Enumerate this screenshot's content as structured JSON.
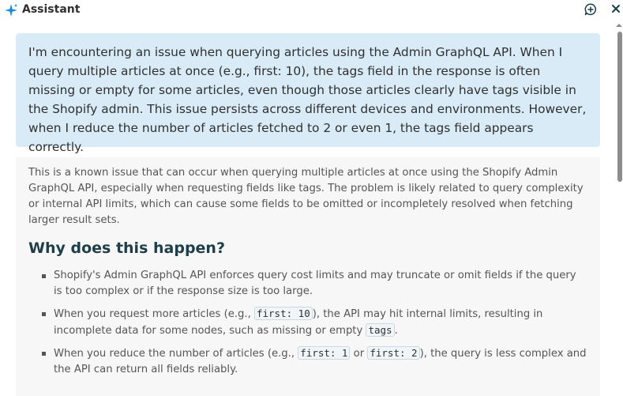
{
  "header": {
    "title": "Assistant",
    "icons": [
      "sparkle-icon",
      "new-chat-icon",
      "close-icon"
    ]
  },
  "colors": {
    "user_bubble_bg": "#d8ebf6",
    "answer_bg": "#f7f7f7",
    "heading": "#1e3f49",
    "body_text": "#555555"
  },
  "conversation": {
    "user_message": "I'm encountering an issue when querying articles using the Admin GraphQL API. When I query multiple articles at once (e.g., first: 10), the tags field in the response is often missing or empty for some articles, even though those articles clearly have tags visible in the Shopify admin. This issue persists across different devices and environments. However, when I reduce the number of articles fetched to 2 or even 1, the tags field appears correctly.",
    "answer": {
      "intro": "This is a known issue that can occur when querying multiple articles at once using the Shopify Admin GraphQL API, especially when requesting fields like tags. The problem is likely related to query complexity or internal API limits, which can cause some fields to be omitted or incompletely resolved when fetching larger result sets.",
      "heading": "Why does this happen?",
      "bullet1": "Shopify's Admin GraphQL API enforces query cost limits and may truncate or omit fields if the query is too complex or if the response size is too large.",
      "bullet2": {
        "t1": "When you request more articles (e.g., ",
        "code1": "first: 10",
        "t2": "), the API may hit internal limits, resulting in incomplete data for some nodes, such as missing or empty ",
        "code2": "tags",
        "t3": "."
      },
      "bullet3": {
        "t1": "When you reduce the number of articles (e.g., ",
        "code1": "first: 1",
        "t2": " or ",
        "code2": "first: 2",
        "t3": "), the query is less complex and the API can return all fields reliably."
      }
    }
  }
}
